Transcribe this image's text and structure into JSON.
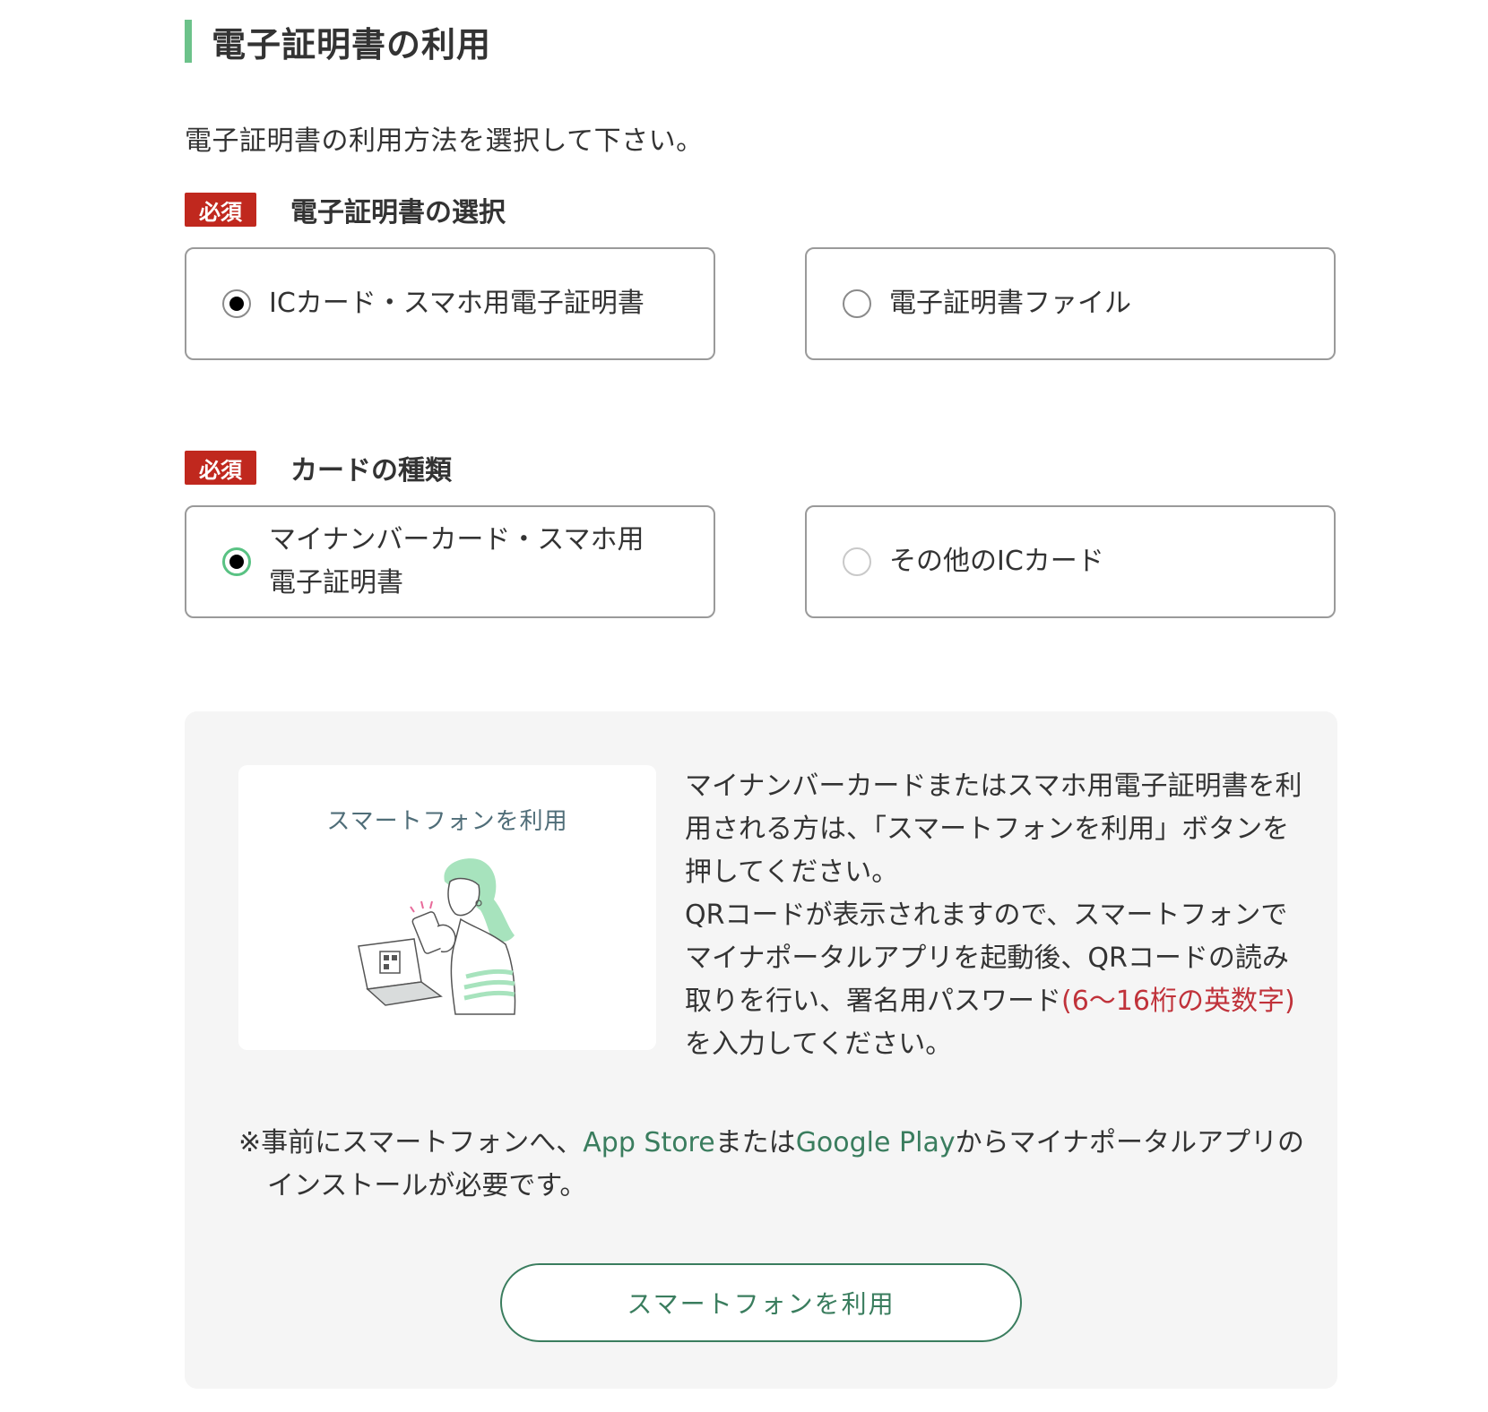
{
  "section": {
    "title": "電子証明書の利用",
    "intro": "電子証明書の利用方法を選択して下さい。"
  },
  "cert_select": {
    "required_label": "必須",
    "label": "電子証明書の選択",
    "options": [
      {
        "label": "ICカード・スマホ用電子証明書",
        "selected": true
      },
      {
        "label": "電子証明書ファイル",
        "selected": false
      }
    ]
  },
  "card_type": {
    "required_label": "必須",
    "label": "カードの種類",
    "options": [
      {
        "label": "マイナンバーカード・スマホ用電子証明書",
        "selected": true
      },
      {
        "label": "その他のICカード",
        "selected": false
      }
    ]
  },
  "panel": {
    "illustration_caption": "スマートフォンを利用",
    "text_part1": "マイナンバーカードまたはスマホ用電子証明書を利用される方は、「スマートフォンを利用」ボタンを押してください。",
    "text_part2": "QRコードが表示されますので、スマートフォンでマイナポータルアプリを起動後、QRコードの読み取りを行い、署名用パスワード",
    "text_highlight": "(6～16桁の英数字)",
    "text_part3": "を入力してください。",
    "note_prefix": "※事前にスマートフォンへ、",
    "note_link1": "App Store",
    "note_mid": "または",
    "note_link2": "Google Play",
    "note_suffix": "からマイナポータルアプリのインストールが必要です。",
    "button_label": "スマートフォンを利用"
  },
  "colors": {
    "accent_green": "#6cc28a",
    "link_green": "#3a7d5e",
    "required_red": "#c0281e",
    "highlight_red": "#c0323a",
    "panel_bg": "#f5f5f5"
  }
}
